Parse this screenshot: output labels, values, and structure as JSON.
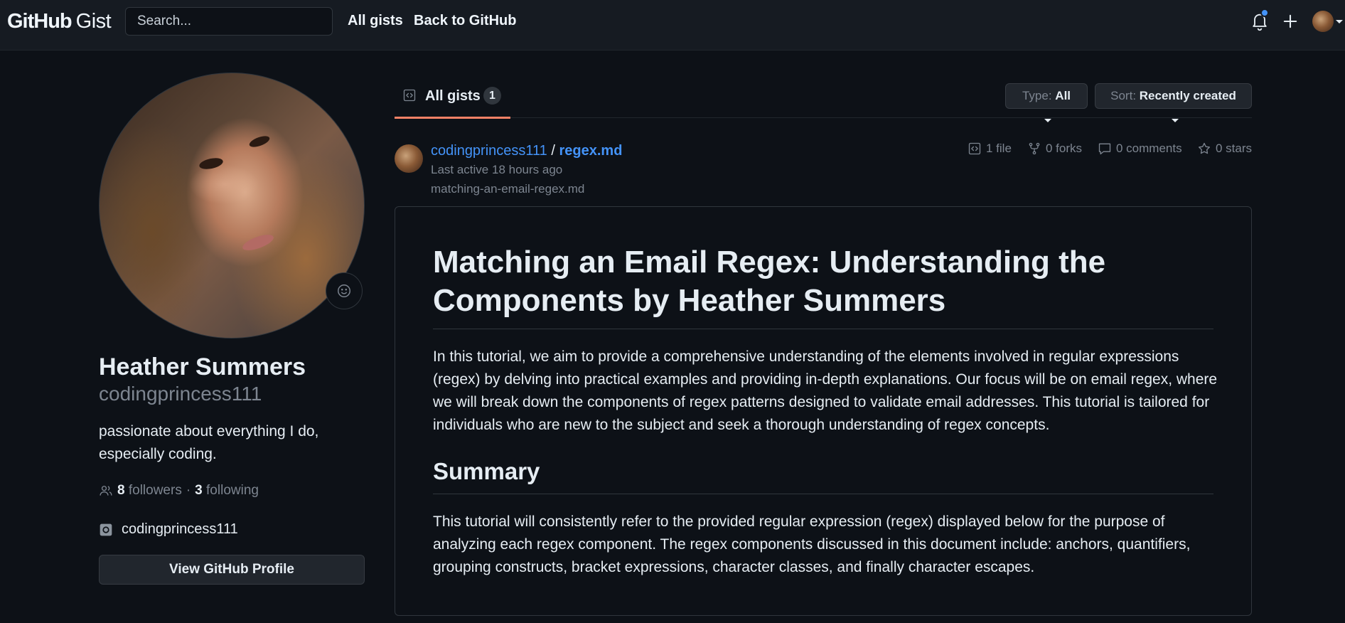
{
  "header": {
    "logo_github": "GitHub",
    "logo_gist": "Gist",
    "search_placeholder": "Search...",
    "nav": {
      "all_gists": "All gists",
      "back": "Back to GitHub"
    },
    "icons": [
      "bell-icon",
      "plus-icon",
      "avatar"
    ]
  },
  "profile": {
    "name": "Heather Summers",
    "login": "codingprincess111",
    "bio": "passionate about everything I do, especially coding.",
    "followers_count": "8",
    "followers_label": "followers",
    "separator": "·",
    "following_count": "3",
    "following_label": "following",
    "social": "codingprincess111",
    "view_profile": "View GitHub Profile"
  },
  "tabs": {
    "label": "All gists",
    "count": "1"
  },
  "filters": {
    "type_prefix": "Type:",
    "type_value": "All",
    "sort_prefix": "Sort:",
    "sort_value": "Recently created"
  },
  "gist": {
    "owner": "codingprincess111",
    "separator": "/",
    "file": "regex.md",
    "last_active": "Last active 18 hours ago",
    "description": "matching-an-email-regex.md",
    "files": "1 file",
    "forks": "0 forks",
    "comments": "0 comments",
    "stars": "0 stars"
  },
  "document": {
    "title": "Matching an Email Regex: Understanding the Components by Heather Summers",
    "intro": "In this tutorial, we aim to provide a comprehensive understanding of the elements involved in regular expressions (regex) by delving into practical examples and providing in-depth explanations. Our focus will be on email regex, where we will break down the components of regex patterns designed to validate email addresses. This tutorial is tailored for individuals who are new to the subject and seek a thorough understanding of regex concepts.",
    "summary_heading": "Summary",
    "summary_text": "This tutorial will consistently refer to the provided regular expression (regex) displayed below for the purpose of analyzing each regex component. The regex components discussed in this document include: anchors, quantifiers, grouping constructs, bracket expressions, character classes, and finally character escapes."
  },
  "colors": {
    "background": "#0d1117",
    "header": "#161b22",
    "link": "#4493f8",
    "tab_underline": "#f78166",
    "muted": "#7d8590",
    "text": "#e6edf3",
    "notification_dot": "#4493f8"
  }
}
